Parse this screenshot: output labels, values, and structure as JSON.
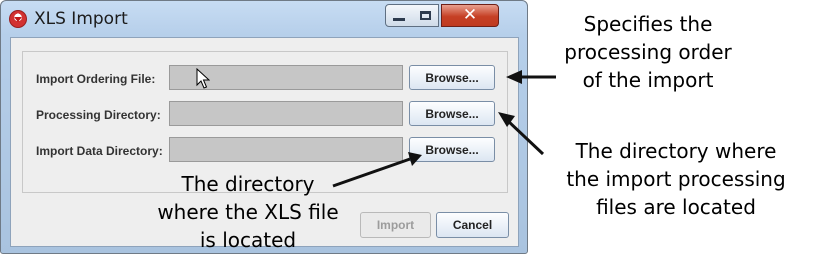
{
  "window": {
    "title": "XLS Import"
  },
  "rows": [
    {
      "label": "Import Ordering File:",
      "browse": "Browse..."
    },
    {
      "label": "Processing Directory:",
      "browse": "Browse..."
    },
    {
      "label": "Import Data Directory:",
      "browse": "Browse..."
    }
  ],
  "actions": {
    "import": "Import",
    "cancel": "Cancel"
  },
  "annotations": {
    "ordering": [
      "Specifies the",
      "processing order",
      "of the import"
    ],
    "processing": [
      "The directory where",
      "the import processing",
      "files are located"
    ],
    "data": [
      "The directory",
      "where the XLS file",
      "is located"
    ]
  }
}
